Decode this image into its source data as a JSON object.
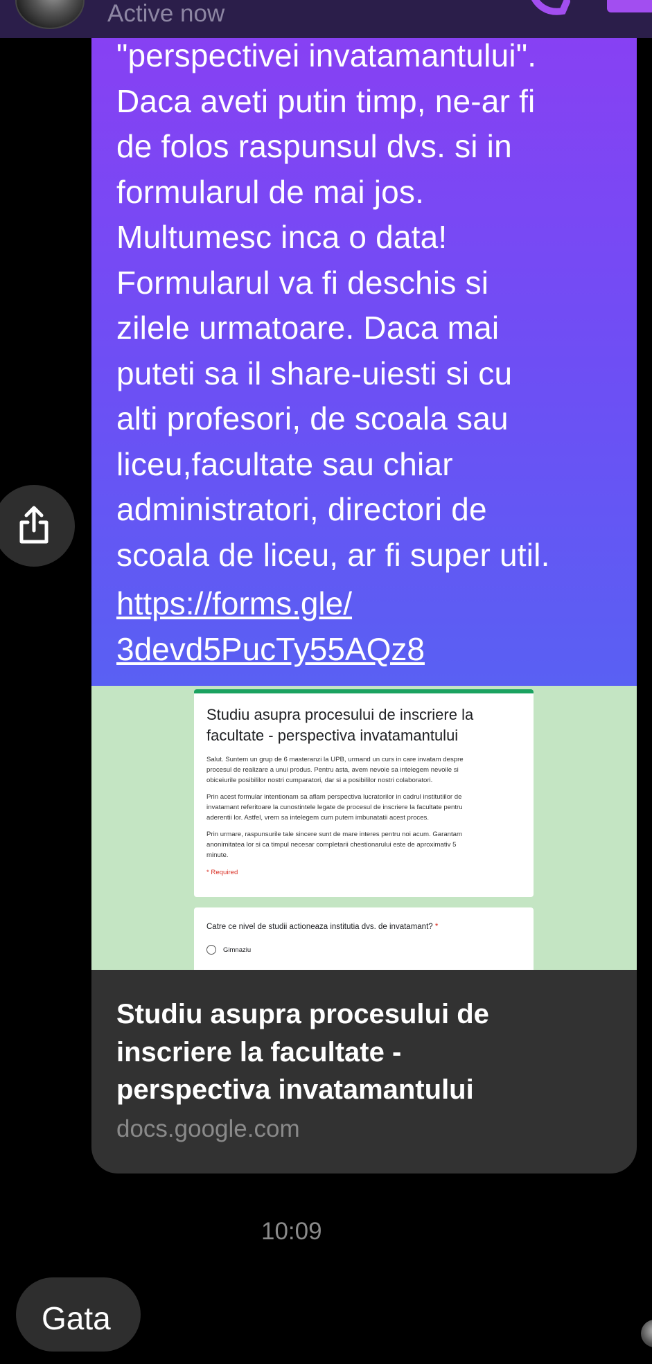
{
  "header": {
    "status": "Active now"
  },
  "message": {
    "text": "\"perspectivei invatamantului\".\nDaca aveti putin timp, ne-ar fi\nde folos raspunsul dvs. si in\nformularul de mai jos.\nMultumesc inca o data!\nFormularul va fi deschis si\nzilele urmatoare. Daca mai\nputeti sa il share-uiesti si cu\nalti profesori, de scoala sau\nliceu,facultate sau chiar\nadministratori, directori de\nscoala de liceu, ar fi super util.",
    "link": "https://forms.gle/\n3devd5PucTy55AQz8"
  },
  "preview": {
    "form_title": "Studiu asupra procesului de inscriere la facultate - perspectiva invatamantului",
    "form_desc_1": "Salut. Suntem un grup de 6 masteranzi la UPB, urmand un curs in care invatam despre\nprocesul de realizare a unui produs. Pentru asta, avem nevoie sa intelegem nevoile si\nobiceiurile posibililor nostri cumparatori, dar si a posibililor nostri colaboratori.",
    "form_desc_2": "Prin acest formular intentionam sa aflam perspectiva lucratorilor in cadrul institutiilor de\ninvatamant referitoare la cunostintele legate de procesul de inscriere la facultate pentru\naderentii lor. Astfel, vrem sa intelegem cum putem imbunatatii acest proces.",
    "form_desc_3": "Prin urmare, raspunsurile tale sincere sunt de mare interes pentru noi acum. Garantam\nanonimitatea lor si ca timpul necesar completarii chestionarului este de aproximativ 5\nminute.",
    "required": "* Required",
    "question": "Catre ce nivel de studii actioneaza institutia dvs. de invatamant?",
    "question_star": " *",
    "option_1": "Gimnaziu",
    "title": "Studiu asupra procesului de\ninscriere la facultate -\nperspectiva invatamantului",
    "domain": "docs.google.com"
  },
  "timestamp": "10:09",
  "reply": {
    "label": "Gata"
  },
  "colors": {
    "bubble_top": "#8a3ff3",
    "bubble_bottom": "#5960f3",
    "preview_bg": "#c4e5c3",
    "card_bg": "#323232",
    "accent": "#a24ef0"
  }
}
